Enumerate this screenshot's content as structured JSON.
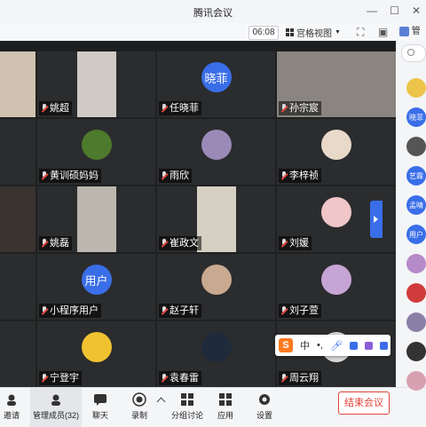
{
  "window": {
    "title": "腾讯会议",
    "controls": [
      "minimize-icon",
      "maximize-icon",
      "close-icon"
    ]
  },
  "toolbar": {
    "timer": "06:08",
    "view_label": "宫格视图",
    "icons": [
      "fullscreen-icon",
      "sidebar-icon",
      "more-icon"
    ]
  },
  "sidebar": {
    "header_label": "管理",
    "avatars": [
      {
        "label": "",
        "color": "#ecc44a"
      },
      {
        "label": "晓菲",
        "color": "#3a6ee8"
      },
      {
        "label": "",
        "color": "#555555"
      },
      {
        "label": "艺霖",
        "color": "#3a6ee8"
      },
      {
        "label": "孟晴",
        "color": "#3a6ee8"
      },
      {
        "label": "用户",
        "color": "#3a6ee8"
      },
      {
        "label": "",
        "color": "#b58ac9"
      },
      {
        "label": "",
        "color": "#d13b3b"
      },
      {
        "label": "",
        "color": "#8a7fa6"
      },
      {
        "label": "",
        "color": "#333333"
      },
      {
        "label": "",
        "color": "#d9a0b2"
      }
    ]
  },
  "participants": [
    {
      "name": "",
      "type": "video",
      "bg": "#cfc2b0"
    },
    {
      "name": "姚超",
      "type": "video",
      "bg": "#cfcac4"
    },
    {
      "name": "任晓菲",
      "type": "avatar-text",
      "avatar_text": "晓菲",
      "color": "#3a6ee8"
    },
    {
      "name": "孙宗宸",
      "type": "video",
      "bg": "#8a8580"
    },
    {
      "name": "",
      "type": "empty"
    },
    {
      "name": "黄训硕妈妈",
      "type": "avatar-image",
      "color": "#4d7a2c"
    },
    {
      "name": "雨欣",
      "type": "avatar-image",
      "color": "#9b8ab8"
    },
    {
      "name": "李梓祯",
      "type": "avatar-image",
      "color": "#e9d9c8"
    },
    {
      "name": "",
      "type": "video",
      "bg": "#3a3330"
    },
    {
      "name": "姚磊",
      "type": "video",
      "bg": "#bcb6ae"
    },
    {
      "name": "崔政文",
      "type": "video",
      "bg": "#d6cfc4"
    },
    {
      "name": "刘媛",
      "type": "avatar-image",
      "color": "#f0c6c9"
    },
    {
      "name": "",
      "type": "empty"
    },
    {
      "name": "小程序用户",
      "type": "avatar-text",
      "avatar_text": "用户",
      "color": "#3a6ee8"
    },
    {
      "name": "赵子轩",
      "type": "avatar-image",
      "color": "#c9a98f"
    },
    {
      "name": "刘子萱",
      "type": "avatar-image",
      "color": "#c7a4d6"
    },
    {
      "name": "",
      "type": "empty"
    },
    {
      "name": "宁登宇",
      "type": "avatar-image",
      "color": "#f1c230"
    },
    {
      "name": "袁春雷",
      "type": "avatar-image",
      "color": "#1f2a3a"
    },
    {
      "name": "周云翔",
      "type": "avatar-image",
      "color": "#d8d8d8"
    }
  ],
  "ime_bar": {
    "logo": "S",
    "lang": "中",
    "icons": [
      "punctuation-icon",
      "microphone-icon",
      "keyboard-icon",
      "skin-icon",
      "toolbox-icon"
    ]
  },
  "bottombar": {
    "buttons": [
      {
        "label": "邀请",
        "icon": "invite-icon"
      },
      {
        "label": "管理成员(32)",
        "icon": "members-icon"
      },
      {
        "label": "聊天",
        "icon": "chat-icon"
      },
      {
        "label": "录制",
        "icon": "record-icon"
      },
      {
        "label": "分组讨论",
        "icon": "breakout-icon"
      },
      {
        "label": "应用",
        "icon": "apps-icon"
      },
      {
        "label": "设置",
        "icon": "settings-icon"
      }
    ],
    "end_label": "结束会议"
  },
  "colors": {
    "accent": "#3a6ee8",
    "end": "#e3433a"
  }
}
